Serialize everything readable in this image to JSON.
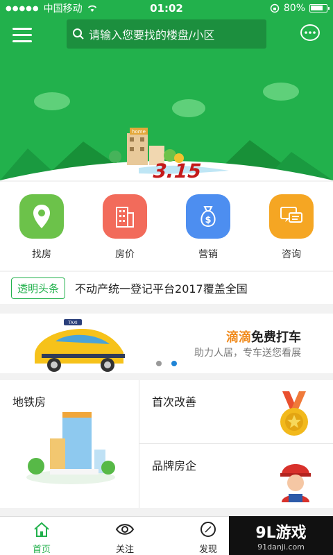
{
  "status_bar": {
    "carrier": "中国移动",
    "time": "01:02",
    "battery": "80%"
  },
  "header": {
    "search_placeholder": "请输入您要找的楼盘/小区"
  },
  "hero": {
    "house_sign": "home"
  },
  "quick_actions": [
    {
      "label": "找房",
      "icon": "location-pin-icon",
      "color": "#6cc24a"
    },
    {
      "label": "房价",
      "icon": "building-icon",
      "color": "#f26b5b"
    },
    {
      "label": "营销",
      "icon": "money-bag-icon",
      "color": "#4d8ef0"
    },
    {
      "label": "咨询",
      "icon": "chat-bubbles-icon",
      "color": "#f5a623"
    }
  ],
  "headline": {
    "tag": "透明头条",
    "text": "不动产统一登记平台2017覆盖全国"
  },
  "banner": {
    "title_highlight": "滴滴",
    "title_rest": "免费打车",
    "subtitle": "助力人居，专车送您看展",
    "taxi_sign": "TAXI"
  },
  "grid": {
    "subway_label": "地铁房",
    "first_improve_label": "首次改善",
    "brand_label": "品牌房企"
  },
  "tabs": [
    {
      "label": "首页",
      "icon": "home-icon",
      "active": true
    },
    {
      "label": "关注",
      "icon": "eye-icon",
      "active": false
    },
    {
      "label": "发现",
      "icon": "compass-icon",
      "active": false
    }
  ],
  "watermark": {
    "logo": "9L游戏",
    "site": "91danji.com"
  },
  "colors": {
    "brand_green": "#22b14c",
    "dark_green": "#1c8f3e",
    "orange": "#f08a1c"
  }
}
